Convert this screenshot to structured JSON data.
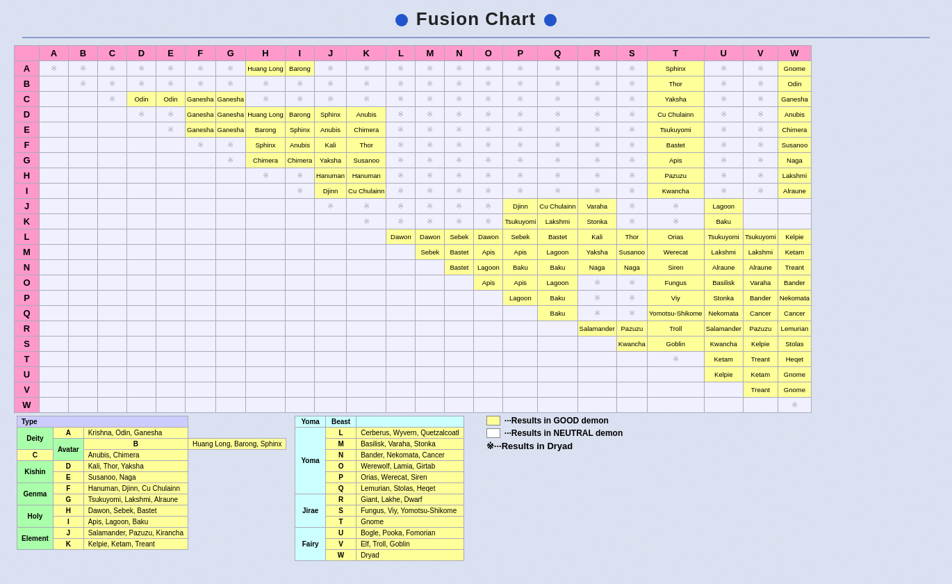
{
  "title": "Fusion Chart",
  "colHeaders": [
    "A",
    "B",
    "C",
    "D",
    "E",
    "F",
    "G",
    "H",
    "I",
    "J",
    "K",
    "L",
    "M",
    "N",
    "O",
    "P",
    "Q",
    "R",
    "S",
    "T",
    "U",
    "V",
    "W"
  ],
  "rowHeaders": [
    "A",
    "B",
    "C",
    "D",
    "E",
    "F",
    "G",
    "H",
    "I",
    "J",
    "K",
    "L",
    "M",
    "N",
    "O",
    "P",
    "Q",
    "R",
    "S",
    "T",
    "U",
    "V",
    "W"
  ],
  "x_mark": "※",
  "gridData": [
    [
      "※",
      "※",
      "※",
      "※",
      "※",
      "※",
      "※",
      "Huang Long",
      "Barong",
      "※",
      "※",
      "※",
      "※",
      "※",
      "※",
      "※",
      "※",
      "※",
      "※",
      "Sphinx",
      "※",
      "※",
      "Gnome"
    ],
    [
      "",
      "※",
      "※",
      "※",
      "※",
      "※",
      "※",
      "※",
      "※",
      "※",
      "※",
      "※",
      "※",
      "※",
      "※",
      "※",
      "※",
      "※",
      "※",
      "Thor",
      "※",
      "※",
      "Odin"
    ],
    [
      "",
      "",
      "※",
      "Odin",
      "Odin",
      "Ganesha",
      "Ganesha",
      "※",
      "※",
      "※",
      "※",
      "※",
      "※",
      "※",
      "※",
      "※",
      "※",
      "※",
      "※",
      "Yaksha",
      "※",
      "※",
      "Ganesha"
    ],
    [
      "",
      "",
      "",
      "※",
      "※",
      "Ganesha",
      "Ganesha",
      "Huang Long",
      "Barong",
      "Sphinx",
      "Anubis",
      "※",
      "※",
      "※",
      "※",
      "※",
      "※",
      "※",
      "※",
      "Cu Chulainn",
      "※",
      "※",
      "Anubis"
    ],
    [
      "",
      "",
      "",
      "",
      "※",
      "Ganesha",
      "Ganesha",
      "Barong",
      "Sphinx",
      "Anubis",
      "Chimera",
      "※",
      "※",
      "※",
      "※",
      "※",
      "※",
      "※",
      "※",
      "Tsukuyomi",
      "※",
      "※",
      "Chimera"
    ],
    [
      "",
      "",
      "",
      "",
      "",
      "※",
      "※",
      "Sphinx",
      "Anubis",
      "Kali",
      "Thor",
      "※",
      "※",
      "※",
      "※",
      "※",
      "※",
      "※",
      "※",
      "Bastet",
      "※",
      "※",
      "Susanoo"
    ],
    [
      "",
      "",
      "",
      "",
      "",
      "",
      "※",
      "Chimera",
      "Chimera",
      "Yaksha",
      "Susanoo",
      "※",
      "※",
      "※",
      "※",
      "※",
      "※",
      "※",
      "※",
      "Apis",
      "※",
      "※",
      "Naga"
    ],
    [
      "",
      "",
      "",
      "",
      "",
      "",
      "",
      "※",
      "※",
      "Hanuman",
      "Hanuman",
      "※",
      "※",
      "※",
      "※",
      "※",
      "※",
      "※",
      "※",
      "Pazuzu",
      "※",
      "※",
      "Lakshmi"
    ],
    [
      "",
      "",
      "",
      "",
      "",
      "",
      "",
      "",
      "※",
      "Djinn",
      "Cu Chulainn",
      "※",
      "※",
      "※",
      "※",
      "※",
      "※",
      "※",
      "※",
      "Kwancha",
      "※",
      "※",
      "Alraune"
    ],
    [
      "",
      "",
      "",
      "",
      "",
      "",
      "",
      "",
      "",
      "※",
      "※",
      "※",
      "※",
      "※",
      "※",
      "Djinn",
      "Cu Chulainn",
      "Varaha",
      "※",
      "※",
      "Lagoon",
      "",
      ""
    ],
    [
      "",
      "",
      "",
      "",
      "",
      "",
      "",
      "",
      "",
      "",
      "※",
      "※",
      "※",
      "※",
      "※",
      "Tsukuyomi",
      "Lakshmi",
      "Stonka",
      "※",
      "※",
      "Baku",
      "",
      ""
    ],
    [
      "",
      "",
      "",
      "",
      "",
      "",
      "",
      "",
      "",
      "",
      "",
      "Dawon",
      "Dawon",
      "Sebek",
      "Dawon",
      "Sebek",
      "Bastet",
      "Kali",
      "Thor",
      "Orias",
      "Tsukuyomi",
      "Tsukuyomi",
      "Kelpie"
    ],
    [
      "",
      "",
      "",
      "",
      "",
      "",
      "",
      "",
      "",
      "",
      "",
      "",
      "Sebek",
      "Bastet",
      "Apis",
      "Apis",
      "Lagoon",
      "Yaksha",
      "Susanoo",
      "Werecat",
      "Lakshmi",
      "Lakshmi",
      "Ketam"
    ],
    [
      "",
      "",
      "",
      "",
      "",
      "",
      "",
      "",
      "",
      "",
      "",
      "",
      "",
      "Bastet",
      "Lagoon",
      "Baku",
      "Baku",
      "Naga",
      "Naga",
      "Siren",
      "Alraune",
      "Alraune",
      "Treant"
    ],
    [
      "",
      "",
      "",
      "",
      "",
      "",
      "",
      "",
      "",
      "",
      "",
      "",
      "",
      "",
      "Apis",
      "Apis",
      "Lagoon",
      "※",
      "※",
      "Fungus",
      "Basilisk",
      "Varaha",
      "Bander"
    ],
    [
      "",
      "",
      "",
      "",
      "",
      "",
      "",
      "",
      "",
      "",
      "",
      "",
      "",
      "",
      "",
      "Lagoon",
      "Baku",
      "※",
      "※",
      "Viy",
      "Stonka",
      "Bander",
      "Nekomata"
    ],
    [
      "",
      "",
      "",
      "",
      "",
      "",
      "",
      "",
      "",
      "",
      "",
      "",
      "",
      "",
      "",
      "",
      "Baku",
      "※",
      "※",
      "Yomotsu-Shikome",
      "Nekomata",
      "Cancer",
      "Cancer"
    ],
    [
      "",
      "",
      "",
      "",
      "",
      "",
      "",
      "",
      "",
      "",
      "",
      "",
      "",
      "",
      "",
      "",
      "",
      "Salamander",
      "Pazuzu",
      "Troll",
      "Salamander",
      "Pazuzu",
      "Lemurian"
    ],
    [
      "",
      "",
      "",
      "",
      "",
      "",
      "",
      "",
      "",
      "",
      "",
      "",
      "",
      "",
      "",
      "",
      "",
      "",
      "Kwancha",
      "Goblin",
      "Kwancha",
      "Kelpie",
      "Stolas"
    ],
    [
      "",
      "",
      "",
      "",
      "",
      "",
      "",
      "",
      "",
      "",
      "",
      "",
      "",
      "",
      "",
      "",
      "",
      "",
      "",
      "※",
      "Ketam",
      "Treant",
      "Heqet"
    ],
    [
      "",
      "",
      "",
      "",
      "",
      "",
      "",
      "",
      "",
      "",
      "",
      "",
      "",
      "",
      "",
      "",
      "",
      "",
      "",
      "",
      "Kelpie",
      "Ketam",
      "Gnome"
    ],
    [
      "",
      "",
      "",
      "",
      "",
      "",
      "",
      "",
      "",
      "",
      "",
      "",
      "",
      "",
      "",
      "",
      "",
      "",
      "",
      "",
      "",
      "Treant",
      "Gnome"
    ],
    [
      "",
      "",
      "",
      "",
      "",
      "",
      "",
      "",
      "",
      "",
      "",
      "",
      "",
      "",
      "",
      "",
      "",
      "",
      "",
      "",
      "",
      "",
      "※"
    ]
  ],
  "typeTable": {
    "header": "Type",
    "rows": [
      {
        "label": "Deity",
        "key": "A",
        "members": "Krishna, Odin, Ganesha"
      },
      {
        "label": "Avatar",
        "key": "B",
        "members": "Huang Long, Barong, Sphinx"
      },
      {
        "label": "",
        "key": "C",
        "members": "Anubis, Chimera"
      },
      {
        "label": "Kishin",
        "key": "D",
        "members": "Kali, Thor, Yaksha"
      },
      {
        "label": "",
        "key": "E",
        "members": "Susanoo, Naga"
      },
      {
        "label": "Genma",
        "key": "F",
        "members": "Hanuman, Djinn, Cu Chulainn"
      },
      {
        "label": "",
        "key": "G",
        "members": "Tsukuyomi, Lakshmi, Alraune"
      },
      {
        "label": "Holy",
        "key": "H",
        "members": "Dawon, Sebek, Bastet"
      },
      {
        "label": "",
        "key": "I",
        "members": "Apis, Lagoon, Baku"
      },
      {
        "label": "Element",
        "key": "J",
        "members": "Salamander, Pazuzu, Kirancha"
      },
      {
        "label": "",
        "key": "K",
        "members": "Kelpie, Ketam, Treant"
      }
    ]
  },
  "beastTable": {
    "header": "Beast",
    "rows": [
      {
        "key": "L",
        "members": "Cerberus, Wyvern, Quetzalcoatl"
      },
      {
        "key": "M",
        "members": "Basilisk, Varaha, Stonka"
      },
      {
        "key": "N",
        "members": "Bander, Nekomata, Cancer"
      },
      {
        "key": "O",
        "members": "Werewolf, Lamia, Girtab"
      },
      {
        "key": "P",
        "members": "Orias, Werecat, Siren"
      },
      {
        "key": "Q",
        "members": "Lemurian, Stolas, Heqet"
      },
      {
        "key": "R",
        "members": "Giant, Lakhe, Dwarf"
      },
      {
        "key": "S",
        "members": "Fungus, Viy, Yomotsu-Shikome"
      },
      {
        "key": "T",
        "members": "Gnome"
      },
      {
        "key": "U",
        "members": "Bogle, Pooka, Fomorian"
      },
      {
        "key": "V",
        "members": "Elf, Troll, Goblin"
      },
      {
        "key": "W",
        "members": "Dryad"
      }
    ]
  },
  "yomaLabel": "Yoma",
  "jiraeLabel": "Jirae",
  "fairyLabel": "Fairy",
  "legend": {
    "good": "···Results in GOOD demon",
    "neutral": "···Results in NEUTRAL demon",
    "dryad": "※···Results in Dryad"
  }
}
